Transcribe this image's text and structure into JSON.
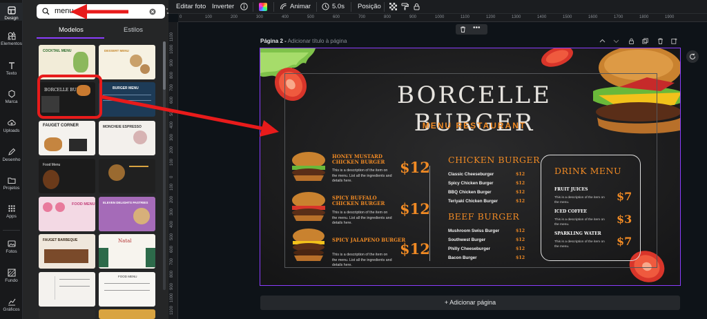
{
  "rail": {
    "items": [
      {
        "label": "Design",
        "icon": "layout-icon"
      },
      {
        "label": "Elementos",
        "icon": "shapes-icon"
      },
      {
        "label": "Texto",
        "icon": "text-icon"
      },
      {
        "label": "Marca",
        "icon": "brand-icon"
      },
      {
        "label": "Uploads",
        "icon": "cloud-upload-icon"
      },
      {
        "label": "Desenho",
        "icon": "pen-icon"
      },
      {
        "label": "Projetos",
        "icon": "folder-icon"
      },
      {
        "label": "Apps",
        "icon": "grid-icon"
      },
      {
        "label": "Fotos",
        "icon": "image-icon"
      },
      {
        "label": "Fundo",
        "icon": "background-icon"
      },
      {
        "label": "Gráficos",
        "icon": "chart-icon"
      }
    ]
  },
  "panel": {
    "search_value": "menu",
    "tabs": [
      "Modelos",
      "Estilos"
    ],
    "thumb_colors": [
      [
        "#f2ecd8",
        "#f6f1e2"
      ],
      [
        "#1a1a1a",
        "#1d3b57"
      ],
      [
        "#f4f2ee",
        "#f3f0ec"
      ],
      [
        "#1b1b1b",
        "#202020"
      ],
      [
        "#f3d9e4",
        "#a56bb8"
      ],
      [
        "#efe7dc",
        "#f7f4ee"
      ],
      [
        "#f4f2ee",
        "#f7f6f3"
      ],
      [
        "#2a2a2a",
        "#d9a441"
      ]
    ]
  },
  "toolbar": {
    "edit_photo": "Editar foto",
    "flip": "Inverter",
    "animate": "Animar",
    "duration": "5.0s",
    "position": "Posição"
  },
  "ruler": {
    "top": [
      "0",
      "100",
      "200",
      "300",
      "400",
      "500",
      "600",
      "700",
      "800",
      "900",
      "1000",
      "1100",
      "1200",
      "1300",
      "1400",
      "1500",
      "1600",
      "1700",
      "1800",
      "1900"
    ],
    "left": [
      "1100",
      "1000",
      "900",
      "800",
      "700",
      "600",
      "500",
      "400",
      "300",
      "200",
      "100",
      "0",
      "100",
      "200",
      "300",
      "400",
      "500",
      "600",
      "700",
      "800",
      "900",
      "1000",
      "1100",
      "1200"
    ]
  },
  "page": {
    "label": "Página 2 -",
    "title_placeholder": "Adicionar título à página",
    "add_page": "+ Adicionar página"
  },
  "design": {
    "title": "BORCELLE BURGER",
    "subtitle": "MENU RESTAURANT",
    "featured": [
      {
        "name_line1": "HONEY MUSTARD",
        "name_line2": "CHICKEN BURGER",
        "desc": "This is a description of the item on the menu. List all the ingredients and details here.",
        "price": "$12"
      },
      {
        "name_line1": "SPICY BUFFALO",
        "name_line2": "CHICKEN BURGER",
        "desc": "This is a description of the item on the menu. List all the ingredients and details here.",
        "price": "$12"
      },
      {
        "name_line1": "SPICY JALAPENO BURGER",
        "name_line2": "",
        "desc": "This is a description of the item on the menu. List all the ingredients and details here.",
        "price": "$12"
      }
    ],
    "chicken": {
      "title": "CHICKEN BURGER",
      "items": [
        {
          "name": "Classic Cheeseburger",
          "price": "$12"
        },
        {
          "name": "Spicy Chicken Burger",
          "price": "$12"
        },
        {
          "name": "BBQ Chicken Burger",
          "price": "$12"
        },
        {
          "name": "Teriyaki Chicken Burger",
          "price": "$12"
        }
      ]
    },
    "beef": {
      "title": "BEEF BURGER",
      "items": [
        {
          "name": "Mushroom Swiss Burger",
          "price": "$12"
        },
        {
          "name": "Southwest Burger",
          "price": "$12"
        },
        {
          "name": "Philly Cheeseburger",
          "price": "$12"
        },
        {
          "name": "Bacon Burger",
          "price": "$12"
        }
      ]
    },
    "drinks": {
      "title": "DRINK MENU",
      "items": [
        {
          "name": "FRUIT JUICES",
          "desc": "This is a description of the item on the menu.",
          "price": "$7"
        },
        {
          "name": "ICED COFFEE",
          "desc": "This is a description of the item on the menu.",
          "price": "$3"
        },
        {
          "name": "SPARKLING WATER",
          "desc": "This is a description of the item on the menu.",
          "price": "$7"
        }
      ]
    }
  },
  "colors": {
    "accent": "#8b3dff",
    "menu_orange": "#f08a24",
    "annotation_red": "#e81b1b"
  }
}
